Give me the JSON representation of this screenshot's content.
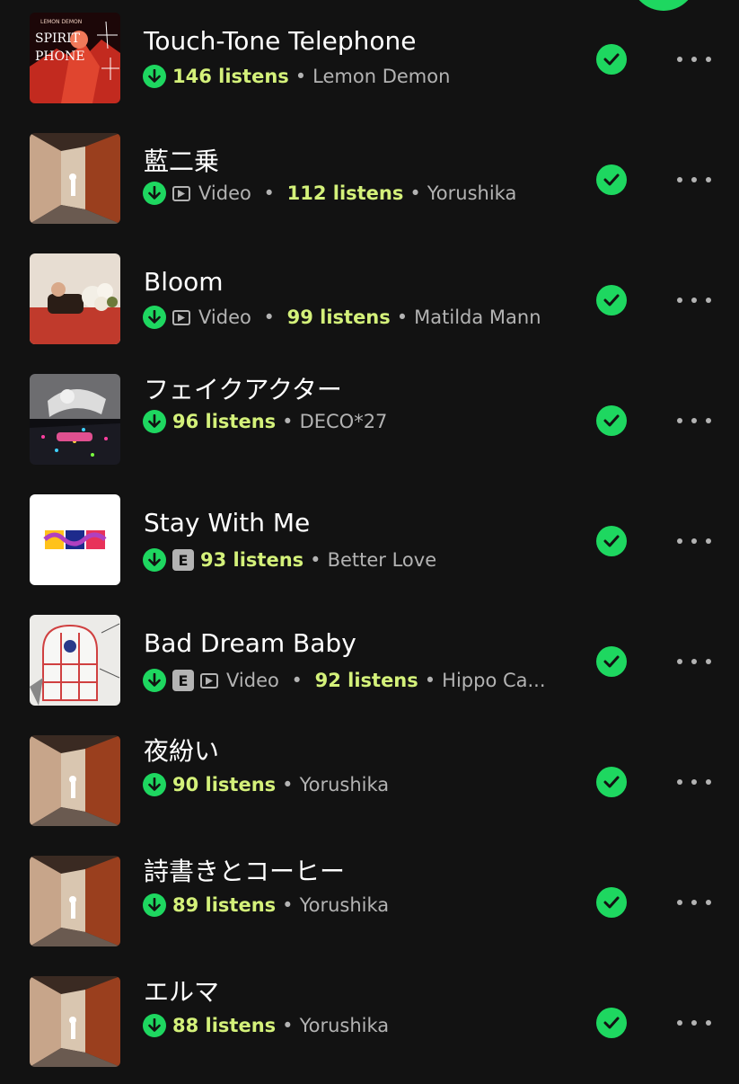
{
  "accent_color": "#1ed760",
  "listens_color": "#d4f17a",
  "tracks": [
    {
      "title": "Touch-Tone Telephone",
      "listens": "146 listens",
      "artist": "Lemon Demon",
      "video": null,
      "explicit": null,
      "art_text": [
        "LEMON DEMON",
        "SPIRIT",
        "PHONE"
      ]
    },
    {
      "title": "藍二乗",
      "listens": "112 listens",
      "artist": "Yorushika",
      "video": "Video",
      "explicit": null
    },
    {
      "title": "Bloom",
      "listens": "99 listens",
      "artist": "Matilda Mann",
      "video": "Video",
      "explicit": null
    },
    {
      "title": "フェイクアクター",
      "listens": "96 listens",
      "artist": "DECO*27",
      "video": null,
      "explicit": null
    },
    {
      "title": "Stay With Me",
      "listens": "93 listens",
      "artist": "Better Love",
      "video": null,
      "explicit": "E"
    },
    {
      "title": "Bad Dream Baby",
      "listens": "92 listens",
      "artist": "Hippo Ca...",
      "video": "Video",
      "explicit": "E"
    },
    {
      "title": "夜紛い",
      "listens": "90 listens",
      "artist": "Yorushika",
      "video": null,
      "explicit": null
    },
    {
      "title": "詩書きとコーヒー",
      "listens": "89 listens",
      "artist": "Yorushika",
      "video": null,
      "explicit": null
    },
    {
      "title": "エルマ",
      "listens": "88 listens",
      "artist": "Yorushika",
      "video": null,
      "explicit": null
    }
  ]
}
